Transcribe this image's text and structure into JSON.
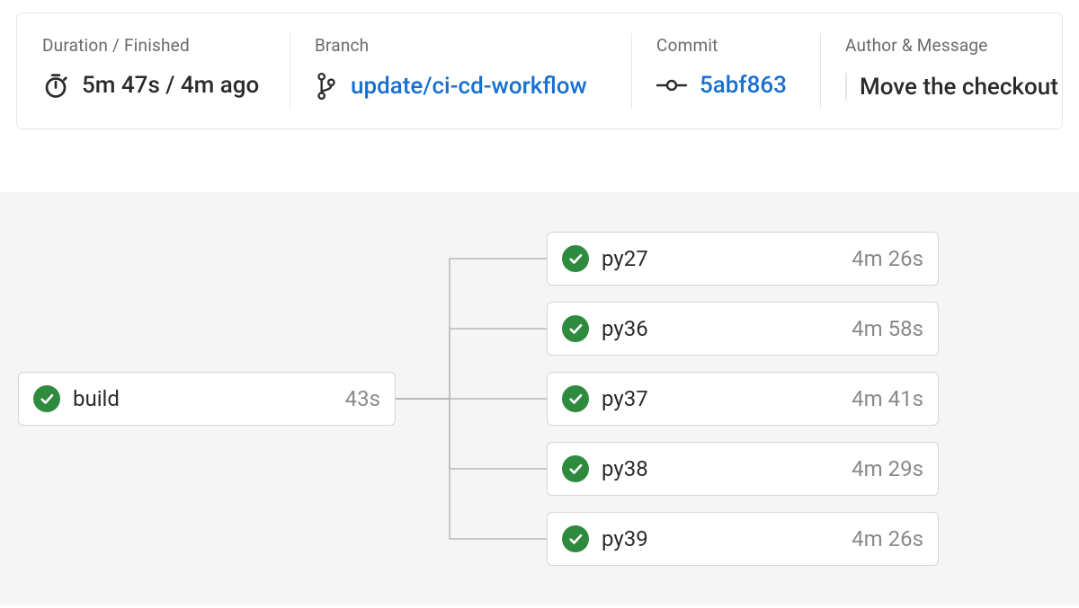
{
  "header": {
    "duration_label": "Duration / Finished",
    "duration_value": "5m 47s / 4m ago",
    "branch_label": "Branch",
    "branch_value": "update/ci-cd-workflow",
    "commit_label": "Commit",
    "commit_value": "5abf863",
    "author_label": "Author & Message",
    "author_message": "Move the checkout"
  },
  "pipeline": {
    "root": {
      "name": "build",
      "duration": "43s",
      "status": "success"
    },
    "children": [
      {
        "name": "py27",
        "duration": "4m 26s",
        "status": "success"
      },
      {
        "name": "py36",
        "duration": "4m 58s",
        "status": "success"
      },
      {
        "name": "py37",
        "duration": "4m 41s",
        "status": "success"
      },
      {
        "name": "py38",
        "duration": "4m 29s",
        "status": "success"
      },
      {
        "name": "py39",
        "duration": "4m 26s",
        "status": "success"
      }
    ]
  },
  "colors": {
    "success": "#2e8b3d",
    "link": "#1770d0"
  }
}
